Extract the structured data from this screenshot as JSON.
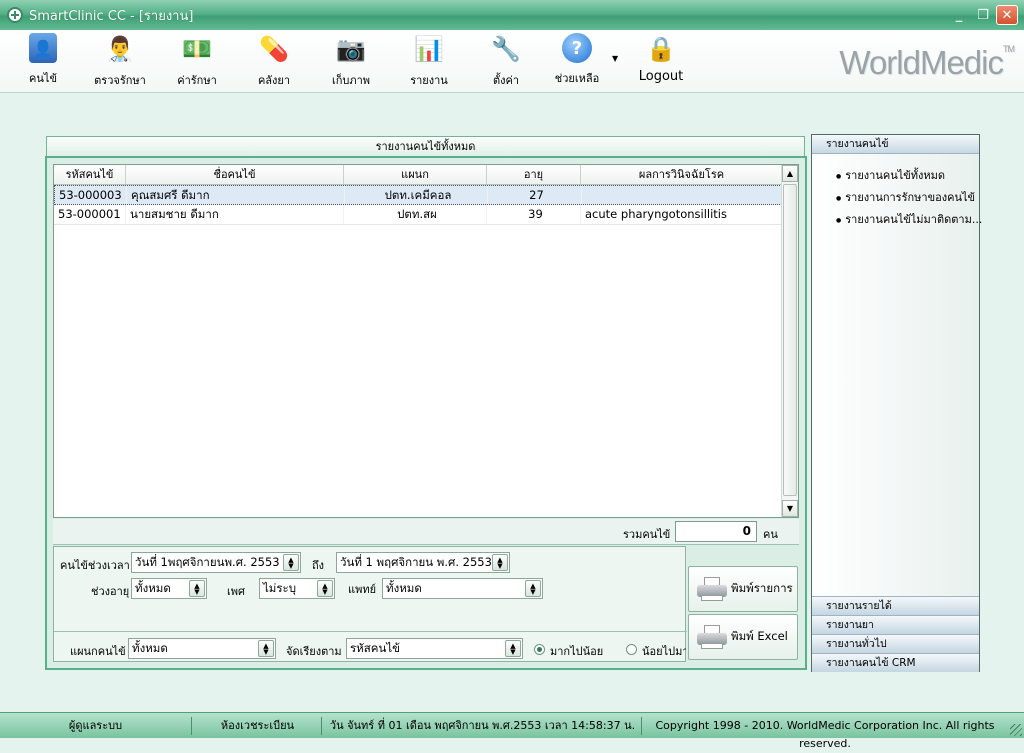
{
  "window": {
    "title": "SmartClinic CC - [รายงาน]"
  },
  "toolbar": {
    "items": [
      {
        "label": "คนไข้",
        "icon": "patient-book-icon"
      },
      {
        "label": "ตรวจรักษา",
        "icon": "doctor-icon"
      },
      {
        "label": "ค่ารักษา",
        "icon": "money-icon"
      },
      {
        "label": "คลังยา",
        "icon": "capsule-icon"
      },
      {
        "label": "เก็บภาพ",
        "icon": "camera-icon"
      },
      {
        "label": "รายงาน",
        "icon": "bar-chart-icon"
      },
      {
        "label": "ตั้งค่า",
        "icon": "tools-icon"
      },
      {
        "label": "ช่วยเหลือ",
        "icon": "help-icon"
      },
      {
        "label": "Logout",
        "icon": "lock-icon"
      }
    ],
    "logo": "WorldMedic",
    "logo_tm": "TM"
  },
  "panel": {
    "title": "รายงานคนไข้ทั้งหมด",
    "columns": [
      "รหัสคนไข้",
      "ชื่อคนไข้",
      "แผนก",
      "อายุ",
      "ผลการวินิจฉัยโรค"
    ],
    "rows": [
      {
        "id": "53-000003",
        "name": "คุณสมศรี ดีมาก",
        "dept": "ปตท.เคมีคอล",
        "age": "27",
        "diagnosis": ""
      },
      {
        "id": "53-000001",
        "name": "นายสมชาย ดีมาก",
        "dept": "ปตท.สผ",
        "age": "39",
        "diagnosis": "acute pharyngotonsillitis"
      }
    ],
    "total_label": "รวมคนไข้",
    "total_value": "0",
    "total_unit": "คน"
  },
  "filters": {
    "period_label": "คนไข้ช่วงเวลา",
    "from_date": "วันที่  1พฤศจิกายนพ.ศ.  2553",
    "to_label": "ถึง",
    "to_date": "วันที่  1 พฤศจิกายน พ.ศ.  2553",
    "age_label": "ช่วงอายุ",
    "age_value": "ทั้งหมด",
    "sex_label": "เพศ",
    "sex_value": "ไม่ระบุ",
    "doctor_label": "แพทย์",
    "doctor_value": "ทั้งหมด",
    "dept_label": "แผนกคนไข้",
    "dept_value": "ทั้งหมด",
    "sort_label": "จัดเรียงตาม",
    "sort_value": "รหัสคนไข้",
    "desc_label": "มากไปน้อย",
    "asc_label": "น้อยไปมาก",
    "order_selected": "desc"
  },
  "buttons": {
    "print_list": "พิมพ์รายการ",
    "print_excel": "พิมพ์ Excel"
  },
  "sidebar": {
    "header": "รายงานคนไข้",
    "items": [
      "รายงานคนไข้ทั้งหมด",
      "รายงานการรักษาของคนไข้",
      "รายงานคนไข้ไม่มาติดตาม..."
    ],
    "footer": [
      "รายงานรายได้",
      "รายงานยา",
      "รายงานทั่วไป",
      "รายงานคนไข้ CRM"
    ]
  },
  "status": {
    "user": "ผู้ดูแลระบบ",
    "room": "ห้องเวชระเบียน",
    "datetime": "วัน จันทร์ ที่ 01 เดือน พฤศจิกายน พ.ศ.2553 เวลา 14:58:37 น.",
    "copyright": "Copyright 1998 - 2010. WorldMedic Corporation Inc. All rights reserved."
  },
  "colors": {
    "accent": "#55b289",
    "panel_border": "#58b08a",
    "background": "#e4f3ee"
  }
}
